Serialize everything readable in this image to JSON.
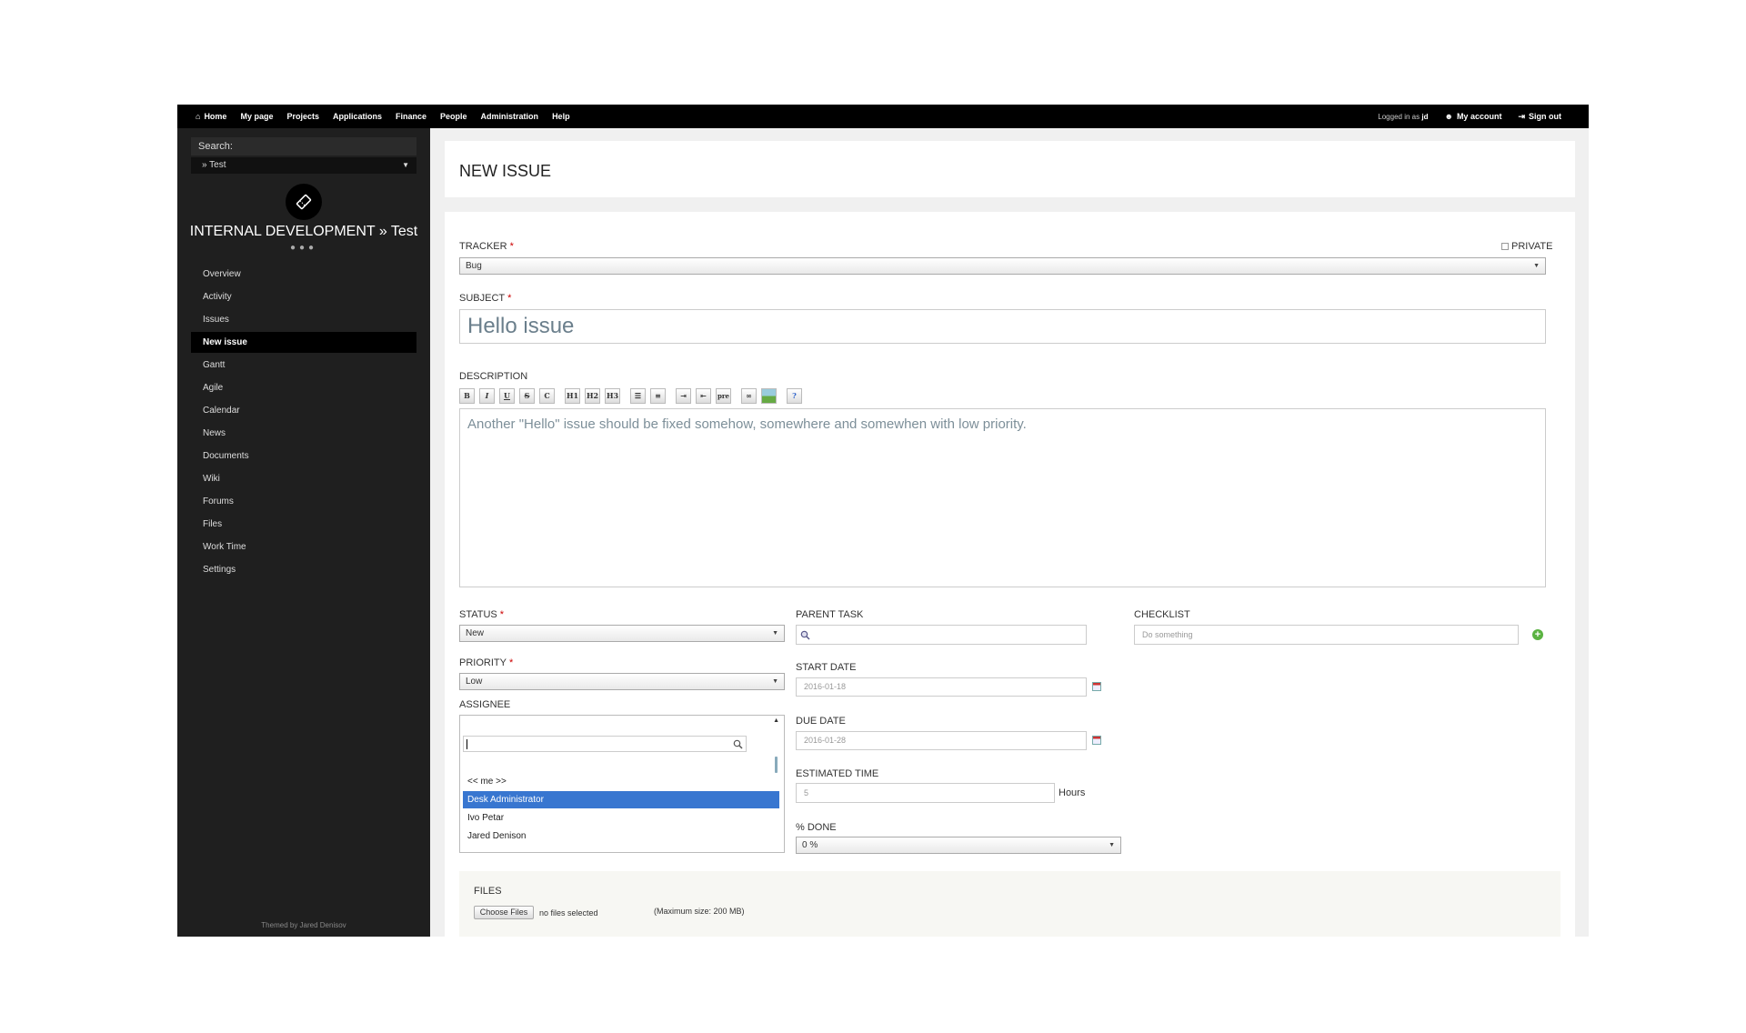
{
  "topmenu": {
    "items": [
      "Home",
      "My page",
      "Projects",
      "Applications",
      "Finance",
      "People",
      "Administration",
      "Help"
    ],
    "logged_in_prefix": "Logged in as",
    "logged_in_user": "jd",
    "my_account": "My account",
    "sign_out": "Sign out"
  },
  "sidebar": {
    "search_label": "Search:",
    "project_select": "» Test",
    "project_title": "INTERNAL DEVELOPMENT » Test",
    "menu": [
      "Overview",
      "Activity",
      "Issues",
      "New issue",
      "Gantt",
      "Agile",
      "Calendar",
      "News",
      "Documents",
      "Wiki",
      "Forums",
      "Files",
      "Work Time",
      "Settings"
    ],
    "selected": "New issue",
    "themed_by": "Themed by Jared Denisov"
  },
  "page": {
    "title": "NEW ISSUE"
  },
  "form": {
    "tracker_label": "TRACKER",
    "tracker_value": "Bug",
    "private_label": "PRIVATE",
    "subject_label": "SUBJECT",
    "subject_value": "Hello issue",
    "description_label": "DESCRIPTION",
    "toolbar": [
      "B",
      "I",
      "U",
      "S",
      "C",
      "H1",
      "H2",
      "H3",
      "ul",
      "ol",
      "in",
      "out",
      "pre",
      "link",
      "img",
      "?"
    ],
    "description_value": "Another \"Hello\" issue should be fixed somehow, somewhere and somewhen with low priority.",
    "status_label": "STATUS",
    "status_value": "New",
    "priority_label": "PRIORITY",
    "priority_value": "Low",
    "assignee_label": "ASSIGNEE",
    "assignee_options": [
      "<< me >>",
      "Desk Administrator",
      "Ivo Petar",
      "Jared Denison"
    ],
    "assignee_selected": "Desk Administrator",
    "parent_task_label": "PARENT TASK",
    "start_date_label": "START DATE",
    "start_date_value": "2016-01-18",
    "due_date_label": "DUE DATE",
    "due_date_value": "2016-01-28",
    "estimated_time_label": "ESTIMATED TIME",
    "estimated_time_value": "5",
    "hours_label": "Hours",
    "done_label": "% DONE",
    "done_value": "0 %",
    "checklist_label": "CHECKLIST",
    "checklist_placeholder": "Do something",
    "files_label": "FILES",
    "choose_files": "Choose Files",
    "no_files": "no files selected",
    "max_size": "(Maximum size: 200 MB)"
  }
}
